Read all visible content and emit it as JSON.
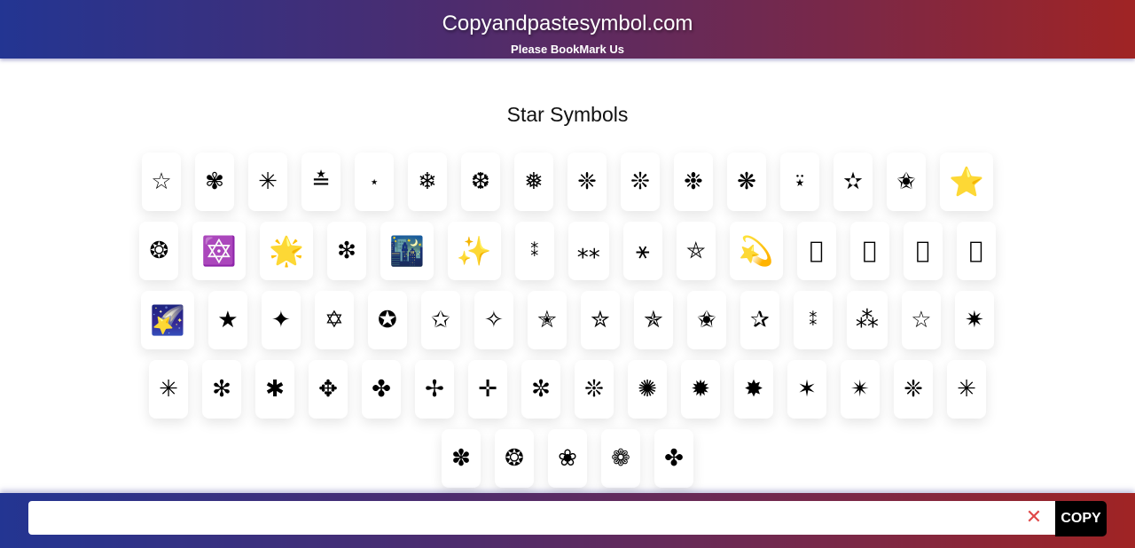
{
  "header": {
    "title": "Copyandpastesymbol.com",
    "subtitle": "Please BookMark Us"
  },
  "page": {
    "title": "Star Symbols"
  },
  "symbols": {
    "rows": [
      [
        "☆",
        "✾",
        "✳",
        "≛",
        "⋆",
        "❄",
        "❆",
        "❅",
        "❈",
        "❊",
        "❉",
        "❋",
        "⍣",
        "✫",
        "✬",
        "⭐"
      ],
      [
        "❂",
        "🔯",
        "🌟",
        "❇",
        "🌃",
        "✨",
        "⁑",
        "⁎⁎",
        "⚹",
        "⛤",
        "💫",
        "",
        "",
        "",
        ""
      ],
      [
        "🌠",
        "★",
        "✦",
        "✡",
        "✪",
        "✩",
        "✧",
        "✭",
        "✮",
        "✯",
        "✬",
        "✰",
        "⁑",
        "⁂",
        "☆",
        "✷"
      ],
      [
        "✳",
        "✻",
        "✱",
        "✥",
        "✤",
        "✢",
        "✛",
        "✼",
        "❊",
        "✺",
        "✹",
        "✸",
        "✶",
        "✴",
        "❈",
        "✳"
      ],
      [
        "✽",
        "❂",
        "❀",
        "❁",
        "✤"
      ]
    ]
  },
  "footer": {
    "input_value": "",
    "input_placeholder": "",
    "clear_icon": "✕",
    "copy_label": "COPY"
  }
}
